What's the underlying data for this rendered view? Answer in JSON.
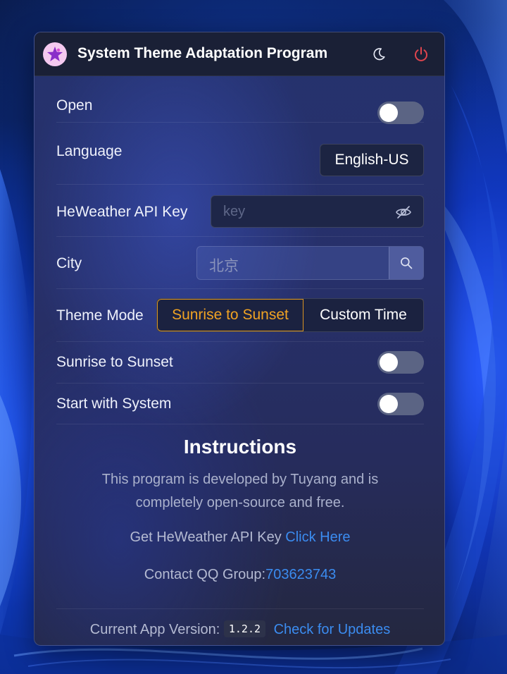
{
  "window": {
    "title": "System Theme Adaptation Program"
  },
  "icons": {
    "logo": "app-logo-star-icon",
    "theme_toggle": "moon-icon",
    "power": "power-icon",
    "visibility": "eye-off-icon",
    "search": "search-icon"
  },
  "settings": {
    "open": {
      "label": "Open",
      "enabled": false
    },
    "language": {
      "label": "Language",
      "value": "English-US"
    },
    "api_key": {
      "label": "HeWeather API Key",
      "placeholder": "key",
      "value": ""
    },
    "city": {
      "label": "City",
      "placeholder": "北京",
      "value": ""
    },
    "theme_mode": {
      "label": "Theme Mode",
      "options": [
        "Sunrise to Sunset",
        "Custom Time"
      ],
      "selected": "Sunrise to Sunset"
    },
    "sunrise_to_sunset": {
      "label": "Sunrise to Sunset",
      "enabled": false
    },
    "start_with_system": {
      "label": "Start with System",
      "enabled": false
    }
  },
  "instructions": {
    "title": "Instructions",
    "text": "This program is developed by Tuyang and is completely open-source and free.",
    "api_key_prefix": "Get HeWeather API Key ",
    "api_key_link": "Click Here",
    "qq_prefix": "Contact QQ Group:",
    "qq_number": "703623743"
  },
  "footer": {
    "version_prefix": "Current App Version: ",
    "version": "1.2.2",
    "update_link": "Check for Updates"
  },
  "colors": {
    "accent": "#f0a323",
    "link": "#3b8cf0",
    "power": "#e0454e"
  }
}
